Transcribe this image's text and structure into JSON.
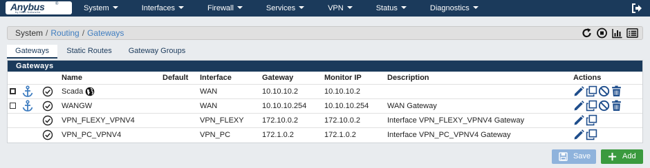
{
  "brand": {
    "name": "Anybus",
    "registered": "®",
    "tagline": "by HMS Networks"
  },
  "nav": {
    "items": [
      "System",
      "Interfaces",
      "Firewall",
      "Services",
      "VPN",
      "Status",
      "Diagnostics"
    ]
  },
  "breadcrumb": {
    "root": "System",
    "section": "Routing",
    "current": "Gateways",
    "separator": "/"
  },
  "tabs": [
    "Gateways",
    "Static Routes",
    "Gateway Groups"
  ],
  "panel": {
    "title": "Gateways"
  },
  "table": {
    "headers": {
      "name": "Name",
      "default": "Default",
      "interface": "Interface",
      "gateway": "Gateway",
      "monitor": "Monitor IP",
      "description": "Description",
      "actions": "Actions"
    },
    "rows": [
      {
        "name": "Scada",
        "default": "",
        "interface": "WAN",
        "gateway": "10.10.10.2",
        "monitor": "10.10.10.2",
        "description": "",
        "has_checkbox": true,
        "checked": true,
        "has_anchor": true,
        "is_default": true
      },
      {
        "name": "WANGW",
        "default": "",
        "interface": "WAN",
        "gateway": "10.10.10.254",
        "monitor": "10.10.10.254",
        "description": "WAN Gateway",
        "has_checkbox": true,
        "checked": false,
        "has_anchor": true,
        "is_default": false
      },
      {
        "name": "VPN_FLEXY_VPNV4",
        "default": "",
        "interface": "VPN_FLEXY",
        "gateway": "172.10.0.2",
        "monitor": "172.10.0.2",
        "description": "Interface VPN_FLEXY_VPNV4 Gateway",
        "has_checkbox": false,
        "checked": false,
        "has_anchor": false,
        "is_default": false
      },
      {
        "name": "VPN_PC_VPNV4",
        "default": "",
        "interface": "VPN_PC",
        "gateway": "172.1.0.2",
        "monitor": "172.1.0.2",
        "description": "Interface VPN_PC_VPNV4 Gateway",
        "has_checkbox": false,
        "checked": false,
        "has_anchor": false,
        "is_default": false
      }
    ]
  },
  "buttons": {
    "save": "Save",
    "add": "Add"
  },
  "colors": {
    "navbar": "#1b3a5b",
    "link": "#3f7dc0",
    "save": "#8fb3dc",
    "add": "#3a9a3e",
    "delete": "#1f4e8c"
  }
}
